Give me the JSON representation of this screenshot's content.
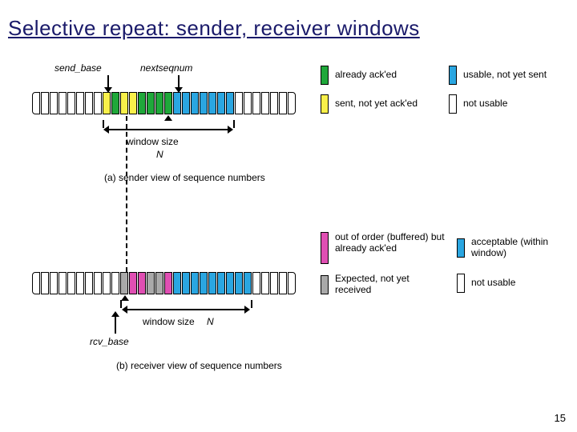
{
  "title": "Selective repeat: sender, receiver windows",
  "page_number": "15",
  "sender": {
    "label_send_base": "send_base",
    "label_nextseqnum": "nextseqnum",
    "label_window_size": "window size",
    "label_N": "N",
    "caption": "(a) sender view of sequence numbers",
    "legend": {
      "already_acked": "already ack'ed",
      "usable_not_sent": "usable, not yet sent",
      "sent_not_acked": "sent, not yet ack'ed",
      "not_usable": "not usable"
    },
    "sequence": [
      "white",
      "white",
      "white",
      "white",
      "white",
      "white",
      "white",
      "white",
      "yellow",
      "green",
      "yellow",
      "yellow",
      "green",
      "green",
      "green",
      "green",
      "blue",
      "blue",
      "blue",
      "blue",
      "blue",
      "blue",
      "blue",
      "white",
      "white",
      "white",
      "white",
      "white",
      "white",
      "white"
    ]
  },
  "receiver": {
    "label_window_size": "window size",
    "label_N": "N",
    "label_rcv_base": "rcv_base",
    "caption": "(b) receiver view of sequence numbers",
    "legend": {
      "buffered": "out of order (buffered) but already ack'ed",
      "acceptable": "acceptable (within window)",
      "expected": "Expected,  not yet received",
      "not_usable": "not usable"
    },
    "sequence": [
      "white",
      "white",
      "white",
      "white",
      "white",
      "white",
      "white",
      "white",
      "white",
      "white",
      "gray",
      "magenta",
      "magenta",
      "gray",
      "gray",
      "magenta",
      "blue",
      "blue",
      "blue",
      "blue",
      "blue",
      "blue",
      "blue",
      "blue",
      "blue",
      "white",
      "white",
      "white",
      "white",
      "white"
    ]
  },
  "colors": {
    "yellow": "#f9f04a",
    "green": "#1fa83a",
    "blue": "#2aa6e1",
    "magenta": "#e04fb3",
    "gray": "#a9a9a9",
    "white": "#ffffff"
  }
}
